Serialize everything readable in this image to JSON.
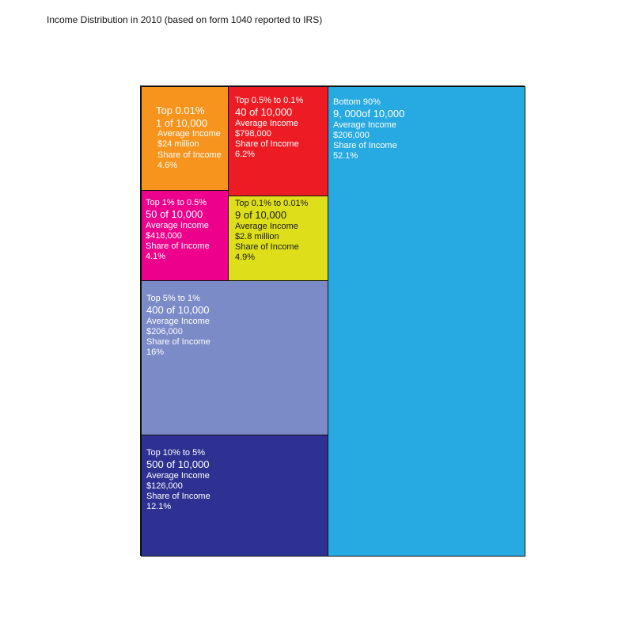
{
  "title": "Income Distribution in 2010 (based on form 1040 reported to IRS)",
  "chart_data": {
    "type": "treemap",
    "title": "Income Distribution in 2010 (based on form 1040 reported to IRS)",
    "cells": [
      {
        "id": "top-0-01",
        "group": "Top 0.01%",
        "count": "1 of 10,000",
        "avg_label": "Average Income",
        "avg": "$24 million",
        "share_label": "Share of Income",
        "share": "4.6%",
        "share_value": 4.6,
        "color": "#f7941d"
      },
      {
        "id": "top-0-5-to-0-1",
        "group": "Top 0.5% to 0.1%",
        "count": "40 of 10,000",
        "avg_label": "Average Income",
        "avg": "$798,000",
        "share_label": "Share of Income",
        "share": "6.2%",
        "share_value": 6.2,
        "color": "#ed1c24"
      },
      {
        "id": "top-1-to-0-5",
        "group": "Top 1% to 0.5%",
        "count": "50 of 10,000",
        "avg_label": "Average Income",
        "avg": "$418,000",
        "share_label": "Share of Income",
        "share": "4.1%",
        "share_value": 4.1,
        "color": "#ec008c"
      },
      {
        "id": "top-0-1-to-0-01",
        "group": "Top 0.1% to 0.01%",
        "count": "9 of 10,000",
        "avg_label": "Average Income",
        "avg": "$2.8 million",
        "share_label": "Share of Income",
        "share": "4.9%",
        "share_value": 4.9,
        "color": "#dede1b"
      },
      {
        "id": "top-5-to-1",
        "group": "Top 5% to 1%",
        "count": "400 of 10,000",
        "avg_label": "Average Income",
        "avg": "$206,000",
        "share_label": "Share of Income",
        "share": "16%",
        "share_value": 16,
        "color": "#7b8bc8"
      },
      {
        "id": "top-10-to-5",
        "group": "Top 10% to 5%",
        "count": "500 of 10,000",
        "avg_label": "Average Income",
        "avg": "$126,000",
        "share_label": "Share of Income",
        "share": "12.1%",
        "share_value": 12.1,
        "color": "#2e3192"
      },
      {
        "id": "bottom-90",
        "group": "Bottom 90%",
        "count": "9, 000of 10,000",
        "avg_label": "Average Income",
        "avg": "$206,000",
        "share_label": "Share of Income",
        "share": "52.1%",
        "share_value": 52.1,
        "color": "#27aae1"
      }
    ]
  }
}
